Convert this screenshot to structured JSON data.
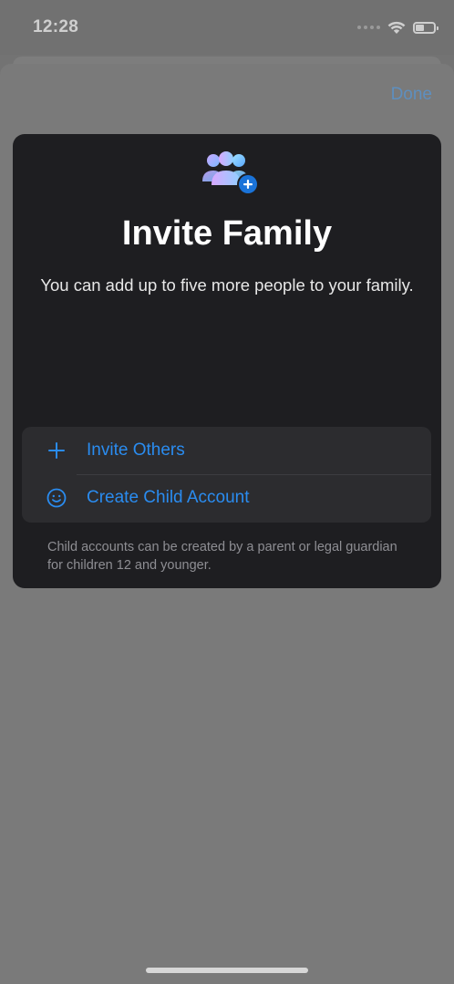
{
  "status_bar": {
    "time": "12:28",
    "battery_level": 0.45,
    "icons": [
      "signal-dots-icon",
      "wifi-icon",
      "battery-icon"
    ]
  },
  "nav": {
    "done_label": "Done"
  },
  "card": {
    "icon": "family-add-icon",
    "title": "Invite Family",
    "subtitle": "You can add up to five more people to your family.",
    "options": [
      {
        "icon": "plus-icon",
        "label": "Invite Others"
      },
      {
        "icon": "smiley-face-icon",
        "label": "Create Child Account"
      }
    ],
    "footnote": "Child accounts can be created by a parent or legal guardian for children 12 and younger."
  },
  "colors": {
    "accent": "#2a8cf0",
    "card_background": "#1e1e21",
    "options_background": "#2c2c2f",
    "dimmed_background": "#737373"
  }
}
